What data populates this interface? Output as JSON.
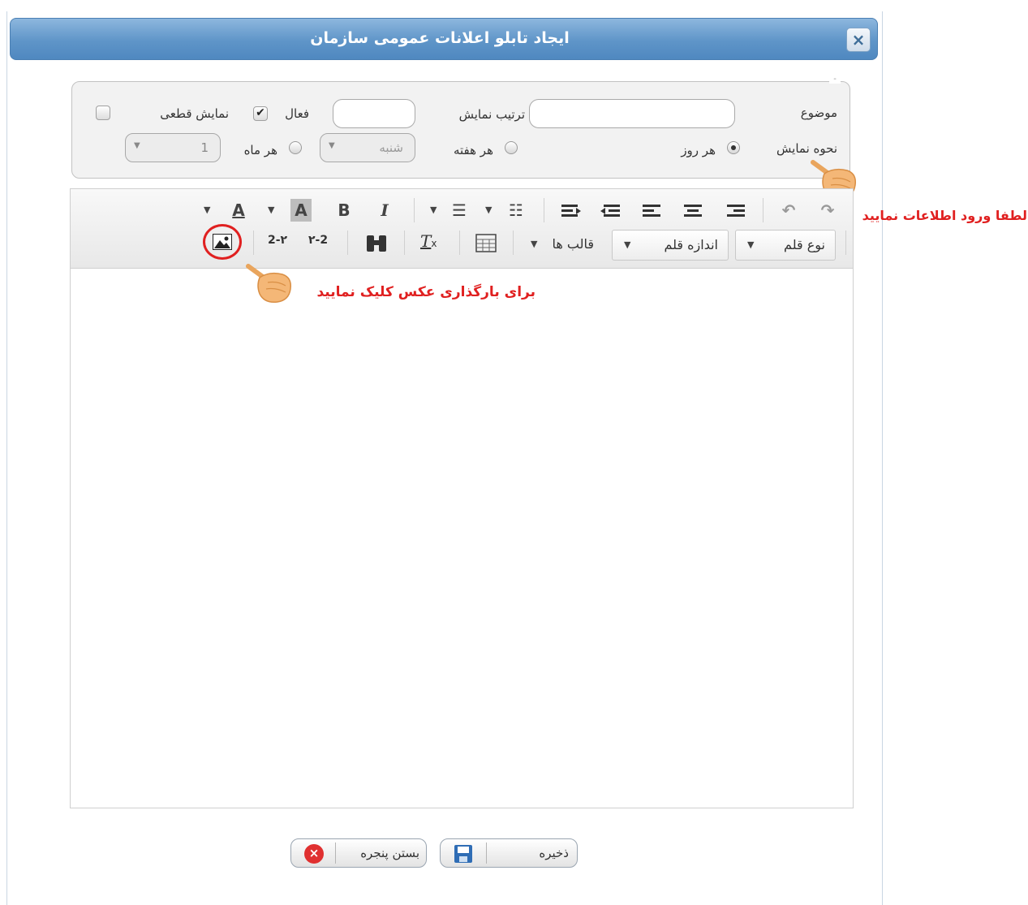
{
  "dialog": {
    "title": "ایجاد تابلو اعلانات عمومی سازمان",
    "close_icon": "×"
  },
  "form": {
    "subject_label": "موضوع",
    "subject_value": "",
    "display_order_label": "ترتیب نمایش",
    "display_order_value": "",
    "active_label": "فعال",
    "active_checked": true,
    "final_display_label": "نمایش قطعی",
    "final_display_checked": false,
    "display_mode_label": "نحوه نمایش",
    "every_day_label": "هر روز",
    "every_week_label": "هر هفته",
    "every_month_label": "هر ماه",
    "selected_mode": "every_day",
    "weekday_value": "شنبه",
    "month_day_value": "1",
    "dropdown_arrow": "▼"
  },
  "toolbar": {
    "font_color_glyph": "A",
    "bg_color_glyph": "A",
    "bold_glyph": "B",
    "italic_glyph": "I",
    "ordered_list_glyph": "☰",
    "unordered_list_glyph": "☷",
    "undo_glyph": "↶",
    "redo_glyph": "↷",
    "digits_to_persian": "2-۲",
    "digits_to_latin": "۲-2",
    "clear_format_glyph": "T",
    "clear_format_sub": "x",
    "font_name_label": "نوع قلم",
    "font_size_label": "اندازه قلم",
    "templates_label": "قالب ها"
  },
  "hints": {
    "fill_info": "لطفا ورود اطلاعات نمایید",
    "upload_image": "برای بارگذاری عکس کلیک نمایید"
  },
  "buttons": {
    "save_label": "ذخیره",
    "close_label": "بستن پنجره"
  },
  "colors": {
    "title_bar": "#5f95c8",
    "hint_text": "#e02020",
    "close_button_icon": "#e03030",
    "save_icon": "#2f6db5"
  }
}
